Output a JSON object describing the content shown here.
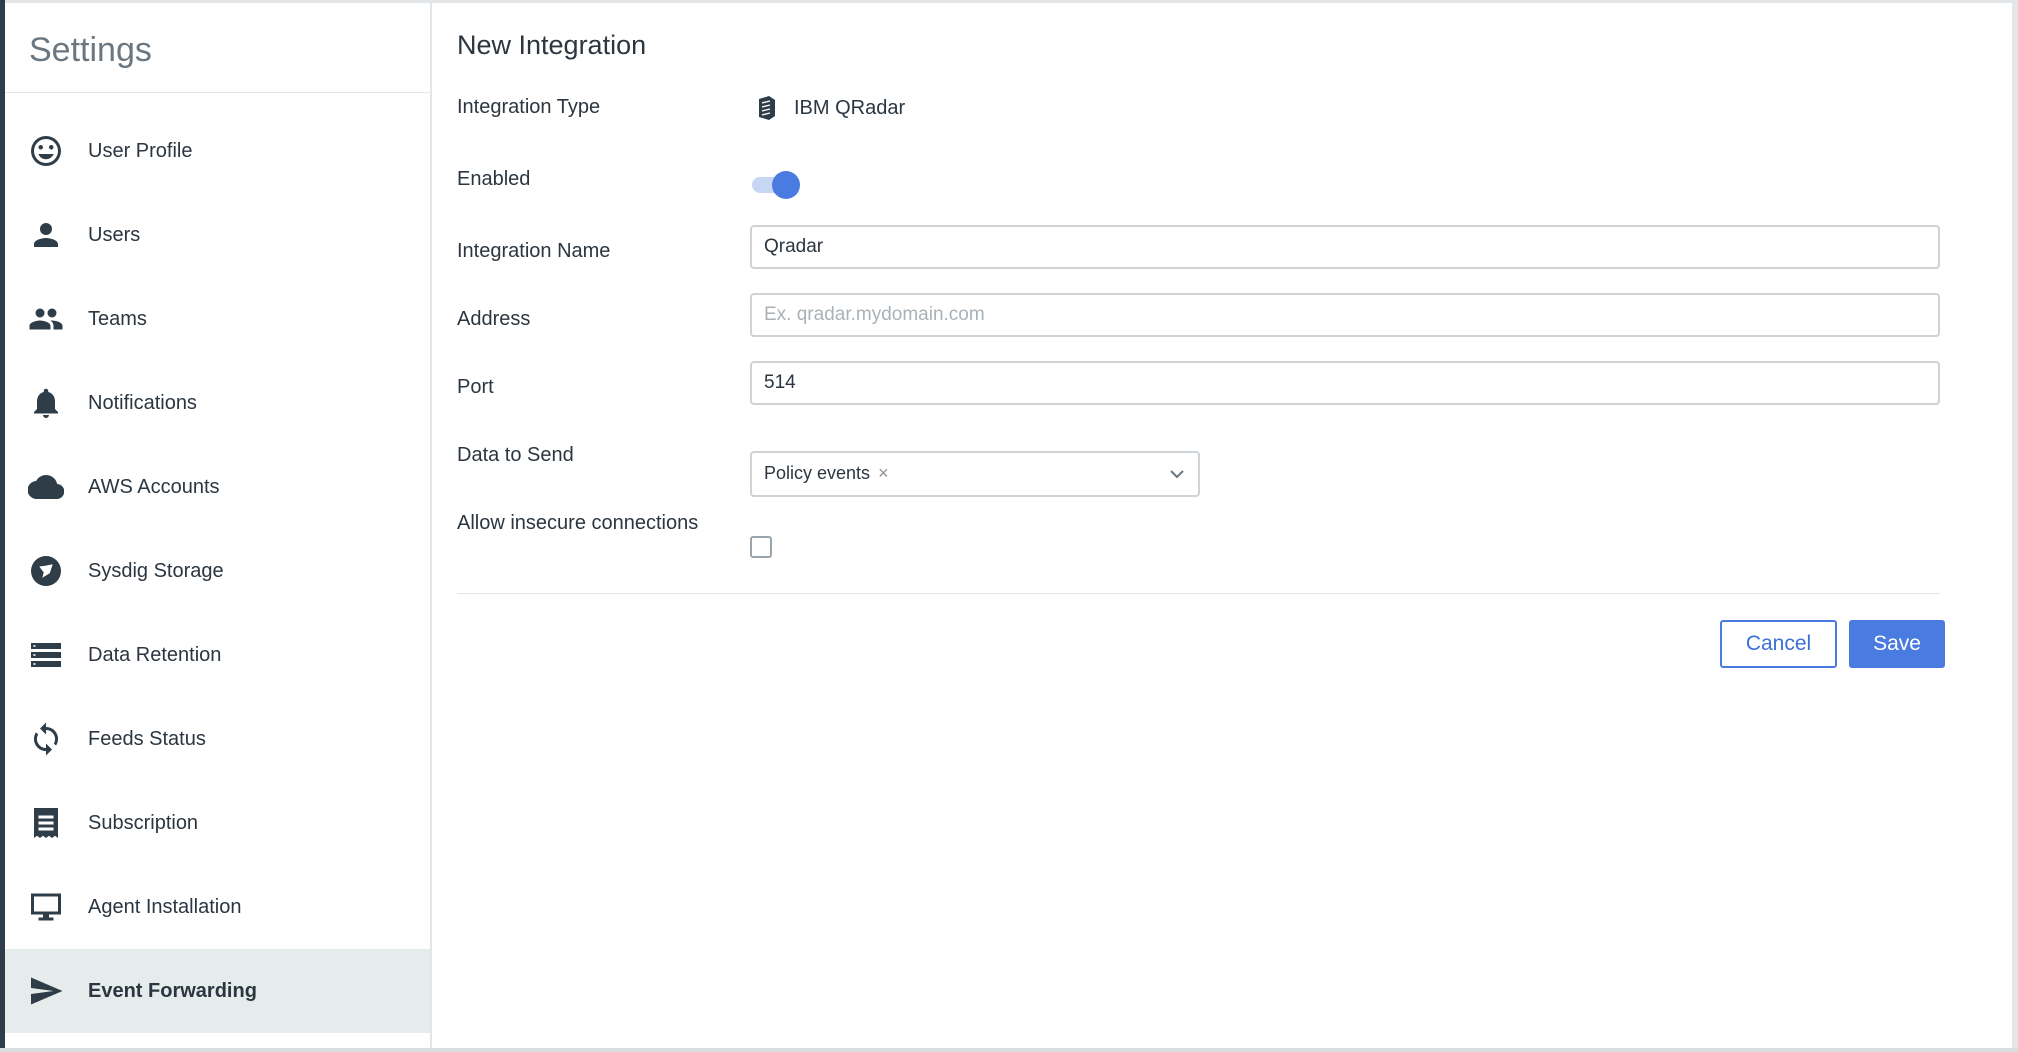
{
  "sidebar": {
    "title": "Settings",
    "items": [
      {
        "label": "User Profile",
        "icon": "smiley-icon"
      },
      {
        "label": "Users",
        "icon": "person-icon"
      },
      {
        "label": "Teams",
        "icon": "people-icon"
      },
      {
        "label": "Notifications",
        "icon": "bell-icon"
      },
      {
        "label": "AWS Accounts",
        "icon": "cloud-icon"
      },
      {
        "label": "Sysdig Storage",
        "icon": "storage-icon"
      },
      {
        "label": "Data Retention",
        "icon": "list-icon"
      },
      {
        "label": "Feeds Status",
        "icon": "sync-icon"
      },
      {
        "label": "Subscription",
        "icon": "receipt-icon"
      },
      {
        "label": "Agent Installation",
        "icon": "monitor-icon"
      },
      {
        "label": "Event Forwarding",
        "icon": "send-icon",
        "active": true
      }
    ]
  },
  "form": {
    "title": "New Integration",
    "integration_type": {
      "label": "Integration Type",
      "value": "IBM QRadar",
      "icon": "qradar-icon"
    },
    "enabled": {
      "label": "Enabled",
      "value": true
    },
    "integration_name": {
      "label": "Integration Name",
      "value": "Qradar"
    },
    "address": {
      "label": "Address",
      "value": "",
      "placeholder": "Ex. qradar.mydomain.com"
    },
    "port": {
      "label": "Port",
      "value": "514"
    },
    "data_to_send": {
      "label": "Data to Send",
      "selected": [
        "Policy events"
      ]
    },
    "allow_insecure": {
      "label": "Allow insecure connections",
      "checked": false
    },
    "cancel_label": "Cancel",
    "save_label": "Save"
  },
  "colors": {
    "accent": "#4a7be0",
    "active_bg": "#e6ecec",
    "text": "#2b3640"
  }
}
